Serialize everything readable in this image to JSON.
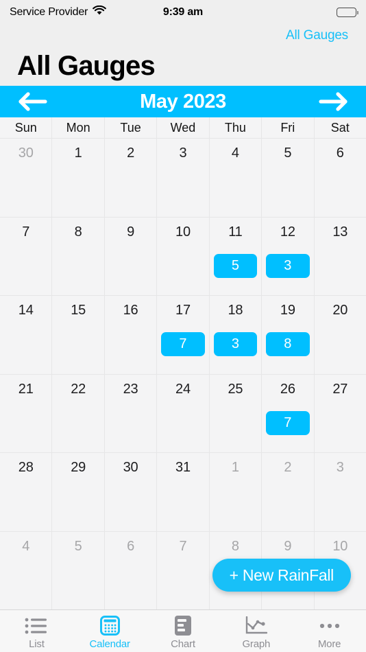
{
  "status_bar": {
    "carrier": "Service Provider",
    "wifi_icon": "wifi-icon",
    "time": "9:39 am",
    "battery_icon": "battery-full-icon"
  },
  "nav": {
    "back_link": "All Gauges"
  },
  "page_title": "All Gauges",
  "month_bar": {
    "prev_icon": "arrow-left-icon",
    "title": "May 2023",
    "next_icon": "arrow-right-icon",
    "background_color": "#00bfff"
  },
  "calendar": {
    "weekdays": [
      "Sun",
      "Mon",
      "Tue",
      "Wed",
      "Thu",
      "Fri",
      "Sat"
    ],
    "accent_color": "#00bfff",
    "rows": [
      [
        {
          "day": "30",
          "muted": true,
          "badge": null
        },
        {
          "day": "1",
          "muted": false,
          "badge": null
        },
        {
          "day": "2",
          "muted": false,
          "badge": null
        },
        {
          "day": "3",
          "muted": false,
          "badge": null
        },
        {
          "day": "4",
          "muted": false,
          "badge": null
        },
        {
          "day": "5",
          "muted": false,
          "badge": null
        },
        {
          "day": "6",
          "muted": false,
          "badge": null
        }
      ],
      [
        {
          "day": "7",
          "muted": false,
          "badge": null
        },
        {
          "day": "8",
          "muted": false,
          "badge": null
        },
        {
          "day": "9",
          "muted": false,
          "badge": null
        },
        {
          "day": "10",
          "muted": false,
          "badge": null
        },
        {
          "day": "11",
          "muted": false,
          "badge": "5"
        },
        {
          "day": "12",
          "muted": false,
          "badge": "3"
        },
        {
          "day": "13",
          "muted": false,
          "badge": null
        }
      ],
      [
        {
          "day": "14",
          "muted": false,
          "badge": null
        },
        {
          "day": "15",
          "muted": false,
          "badge": null
        },
        {
          "day": "16",
          "muted": false,
          "badge": null
        },
        {
          "day": "17",
          "muted": false,
          "badge": "7"
        },
        {
          "day": "18",
          "muted": false,
          "badge": "3"
        },
        {
          "day": "19",
          "muted": false,
          "badge": "8"
        },
        {
          "day": "20",
          "muted": false,
          "badge": null
        }
      ],
      [
        {
          "day": "21",
          "muted": false,
          "badge": null
        },
        {
          "day": "22",
          "muted": false,
          "badge": null
        },
        {
          "day": "23",
          "muted": false,
          "badge": null
        },
        {
          "day": "24",
          "muted": false,
          "badge": null
        },
        {
          "day": "25",
          "muted": false,
          "badge": null
        },
        {
          "day": "26",
          "muted": false,
          "badge": "7"
        },
        {
          "day": "27",
          "muted": false,
          "badge": null
        }
      ],
      [
        {
          "day": "28",
          "muted": false,
          "badge": null
        },
        {
          "day": "29",
          "muted": false,
          "badge": null
        },
        {
          "day": "30",
          "muted": false,
          "badge": null
        },
        {
          "day": "31",
          "muted": false,
          "badge": null
        },
        {
          "day": "1",
          "muted": true,
          "badge": null
        },
        {
          "day": "2",
          "muted": true,
          "badge": null
        },
        {
          "day": "3",
          "muted": true,
          "badge": null
        }
      ],
      [
        {
          "day": "4",
          "muted": true,
          "badge": null
        },
        {
          "day": "5",
          "muted": true,
          "badge": null
        },
        {
          "day": "6",
          "muted": true,
          "badge": null
        },
        {
          "day": "7",
          "muted": true,
          "badge": null
        },
        {
          "day": "8",
          "muted": true,
          "badge": null
        },
        {
          "day": "9",
          "muted": true,
          "badge": null
        },
        {
          "day": "10",
          "muted": true,
          "badge": null
        }
      ]
    ]
  },
  "fab": {
    "label": "+ New RainFall",
    "color": "#18c0f8"
  },
  "tab_bar": {
    "active_index": 1,
    "active_color": "#18c0f8",
    "inactive_color": "#8e8e93",
    "tabs": [
      {
        "label": "List",
        "icon": "list-icon"
      },
      {
        "label": "Calendar",
        "icon": "calendar-icon"
      },
      {
        "label": "Chart",
        "icon": "chart-icon"
      },
      {
        "label": "Graph",
        "icon": "graph-icon"
      },
      {
        "label": "More",
        "icon": "more-ellipsis-icon"
      }
    ]
  }
}
